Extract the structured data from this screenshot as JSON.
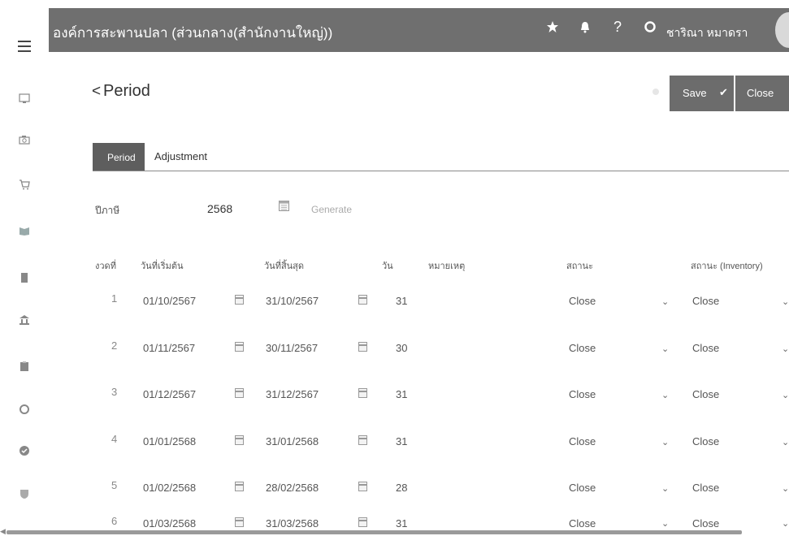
{
  "topbar": {
    "org_name": "องค์การสะพานปลา (ส่วนกลาง(สำนักงานใหญ่))",
    "user_name": "ชาริณา หมาดรา",
    "icons": [
      "star-icon",
      "bell-icon",
      "help-icon",
      "settings-icon"
    ],
    "help_glyph": "?"
  },
  "sidebar": {
    "icons": [
      "monitor-icon",
      "camera-icon",
      "cart-icon",
      "book-icon",
      "document-icon",
      "bank-icon",
      "clipboard-icon",
      "cycle-icon",
      "check-circle-icon",
      "shield-icon"
    ]
  },
  "header": {
    "back_glyph": "<",
    "title": "Period",
    "save_label": "Save",
    "save_glyph": "✔",
    "close_label": "Close"
  },
  "tabs": [
    {
      "label": "Period",
      "active": true
    },
    {
      "label": "Adjustment",
      "active": false
    }
  ],
  "fiscal": {
    "label": "ปีภาษี",
    "year": "2568",
    "generate_label": "Generate"
  },
  "table": {
    "headers": {
      "no": "งวดที่",
      "start": "วันที่เริ่มต้น",
      "end": "วันที่สิ้นสุด",
      "days": "วัน",
      "remark": "หมายเหตุ",
      "status": "สถานะ",
      "inv_status": "สถานะ (Inventory)"
    },
    "rows": [
      {
        "no": "1",
        "start": "01/10/2567",
        "end": "31/10/2567",
        "days": "31",
        "remark": "",
        "status": "Close",
        "inv_status": "Close"
      },
      {
        "no": "2",
        "start": "01/11/2567",
        "end": "30/11/2567",
        "days": "30",
        "remark": "",
        "status": "Close",
        "inv_status": "Close"
      },
      {
        "no": "3",
        "start": "01/12/2567",
        "end": "31/12/2567",
        "days": "31",
        "remark": "",
        "status": "Close",
        "inv_status": "Close"
      },
      {
        "no": "4",
        "start": "01/01/2568",
        "end": "31/01/2568",
        "days": "31",
        "remark": "",
        "status": "Close",
        "inv_status": "Close"
      },
      {
        "no": "5",
        "start": "01/02/2568",
        "end": "28/02/2568",
        "days": "28",
        "remark": "",
        "status": "Close",
        "inv_status": "Close"
      },
      {
        "no": "6",
        "start": "01/03/2568",
        "end": "31/03/2568",
        "days": "31",
        "remark": "",
        "status": "Close",
        "inv_status": "Close"
      }
    ]
  },
  "colors": {
    "topbar_bg": "#6f6f6f",
    "button_bg": "#6c6c6c",
    "tab_active_bg": "#5e5e5e"
  }
}
